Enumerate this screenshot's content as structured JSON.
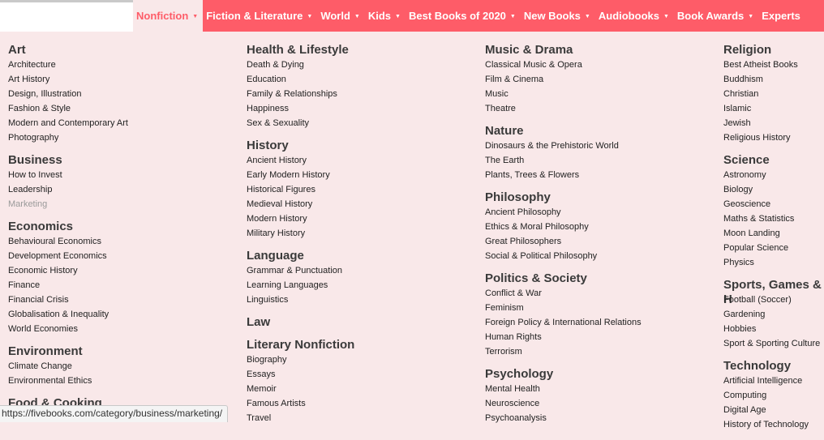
{
  "nav": [
    {
      "label": "Nonfiction",
      "active": true
    },
    {
      "label": "Fiction & Literature",
      "active": false
    },
    {
      "label": "World",
      "active": false
    },
    {
      "label": "Kids",
      "active": false
    },
    {
      "label": "Best Books of 2020",
      "active": false
    },
    {
      "label": "New Books",
      "active": false
    },
    {
      "label": "Audiobooks",
      "active": false
    },
    {
      "label": "Book Awards",
      "active": false
    },
    {
      "label": "Experts",
      "active": false
    }
  ],
  "columns": [
    {
      "groups": [
        {
          "title": "Art",
          "links": [
            "Architecture",
            "Art History",
            "Design, Illustration",
            "Fashion & Style",
            "Modern and Contemporary Art",
            "Photography"
          ]
        },
        {
          "title": "Business",
          "links": [
            "How to Invest",
            "Leadership",
            "Marketing"
          ]
        },
        {
          "title": "Economics",
          "links": [
            "Behavioural Economics",
            "Development Economics",
            "Economic History",
            "Finance",
            "Financial Crisis",
            "Globalisation & Inequality",
            "World Economies"
          ]
        },
        {
          "title": "Environment",
          "links": [
            "Climate Change",
            "Environmental Ethics"
          ]
        },
        {
          "title": "Food & Cooking",
          "links": []
        }
      ]
    },
    {
      "groups": [
        {
          "title": "Health & Lifestyle",
          "links": [
            "Death & Dying",
            "Education",
            "Family & Relationships",
            "Happiness",
            "Sex & Sexuality"
          ]
        },
        {
          "title": "History",
          "links": [
            "Ancient History",
            "Early Modern History",
            "Historical Figures",
            "Medieval History",
            "Modern History",
            "Military History"
          ]
        },
        {
          "title": "Language",
          "links": [
            "Grammar & Punctuation",
            "Learning Languages",
            "Linguistics"
          ]
        },
        {
          "title": "Law",
          "links": []
        },
        {
          "title": "Literary Nonfiction",
          "links": [
            "Biography",
            "Essays",
            "Memoir",
            "Famous Artists",
            "Travel"
          ]
        }
      ]
    },
    {
      "groups": [
        {
          "title": "Music & Drama",
          "links": [
            "Classical Music & Opera",
            "Film & Cinema",
            "Music",
            "Theatre"
          ]
        },
        {
          "title": "Nature",
          "links": [
            "Dinosaurs & the Prehistoric World",
            "The Earth",
            "Plants, Trees & Flowers"
          ]
        },
        {
          "title": "Philosophy",
          "links": [
            "Ancient Philosophy",
            "Ethics & Moral Philosophy",
            "Great Philosophers",
            "Social & Political Philosophy"
          ]
        },
        {
          "title": "Politics & Society",
          "links": [
            "Conflict & War",
            "Feminism",
            "Foreign Policy & International Relations",
            "Human Rights",
            "Terrorism"
          ]
        },
        {
          "title": "Psychology",
          "links": [
            "Mental Health",
            "Neuroscience",
            "Psychoanalysis"
          ]
        }
      ]
    },
    {
      "groups": [
        {
          "title": "Religion",
          "links": [
            "Best Atheist Books",
            "Buddhism",
            "Christian",
            "Islamic",
            "Jewish",
            "Religious History"
          ]
        },
        {
          "title": "Science",
          "links": [
            "Astronomy",
            "Biology",
            "Geoscience",
            "Maths & Statistics",
            "Moon Landing",
            "Popular Science",
            "Physics"
          ]
        },
        {
          "title": "Sports, Games & H",
          "links": [
            "Football (Soccer)",
            "Gardening",
            "Hobbies",
            "Sport & Sporting Culture"
          ]
        },
        {
          "title": "Technology",
          "links": [
            "Artificial Intelligence",
            "Computing",
            "Digital Age",
            "History of Technology"
          ]
        }
      ]
    }
  ],
  "muted_link": "Marketing",
  "status_url": "https://fivebooks.com/category/business/marketing/"
}
